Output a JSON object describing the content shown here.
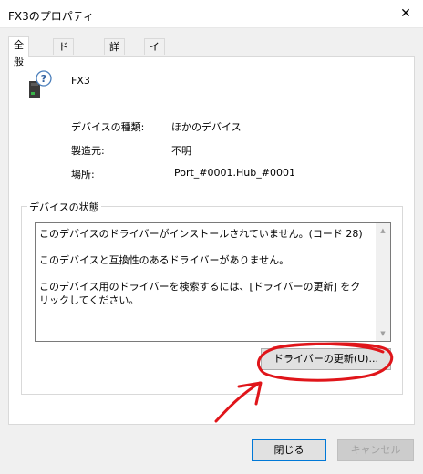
{
  "window": {
    "title": "FX3のプロパティ"
  },
  "tabs": [
    {
      "label": "全般",
      "active": true
    },
    {
      "label": "ドライバー",
      "active": false
    },
    {
      "label": "詳細",
      "active": false
    },
    {
      "label": "イベント",
      "active": false
    }
  ],
  "device": {
    "name": "FX3",
    "icon": "unknown-device-icon",
    "properties": [
      {
        "label": "デバイスの種類:",
        "value": "ほかのデバイス"
      },
      {
        "label": "製造元:",
        "value": "不明"
      },
      {
        "label": "場所:",
        "value": "Port_#0001.Hub_#0001"
      }
    ]
  },
  "status": {
    "group_title": "デバイスの状態",
    "lines": [
      "このデバイスのドライバーがインストールされていません。(コード 28)",
      "このデバイスと互換性のあるドライバーがありません。",
      "このデバイス用のドライバーを検索するには、[ドライバーの更新] をクリックしてください。"
    ],
    "update_button": "ドライバーの更新(U)..."
  },
  "footer": {
    "ok_label": "閉じる",
    "cancel_label": "キャンセル"
  },
  "colors": {
    "accent": "#0078d7",
    "annotation": "#e0151a"
  }
}
